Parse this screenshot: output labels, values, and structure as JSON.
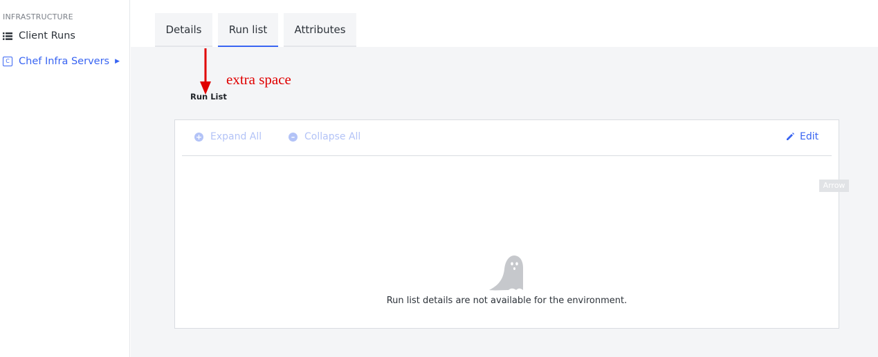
{
  "sidebar": {
    "section_label": "INFRASTRUCTURE",
    "items": [
      {
        "label": "Client Runs",
        "icon": "list-icon"
      },
      {
        "label": "Chef Infra Servers",
        "icon": "chef-c-icon",
        "badge": "C"
      }
    ]
  },
  "tabs": [
    {
      "label": "Details",
      "active": false
    },
    {
      "label": "Run list",
      "active": true
    },
    {
      "label": "Attributes",
      "active": false
    }
  ],
  "annotation": {
    "text": "extra space",
    "color": "#e00000"
  },
  "run_list": {
    "title": "Run List",
    "toolbar": {
      "expand_label": "Expand All",
      "collapse_label": "Collapse All",
      "edit_label": "Edit"
    },
    "tooltip": "Arrow",
    "empty_message": "Run list details are not available for the environment."
  },
  "colors": {
    "accent": "#3864f2",
    "disabled": "#b3c3f7",
    "content_bg": "#f4f5f7"
  }
}
